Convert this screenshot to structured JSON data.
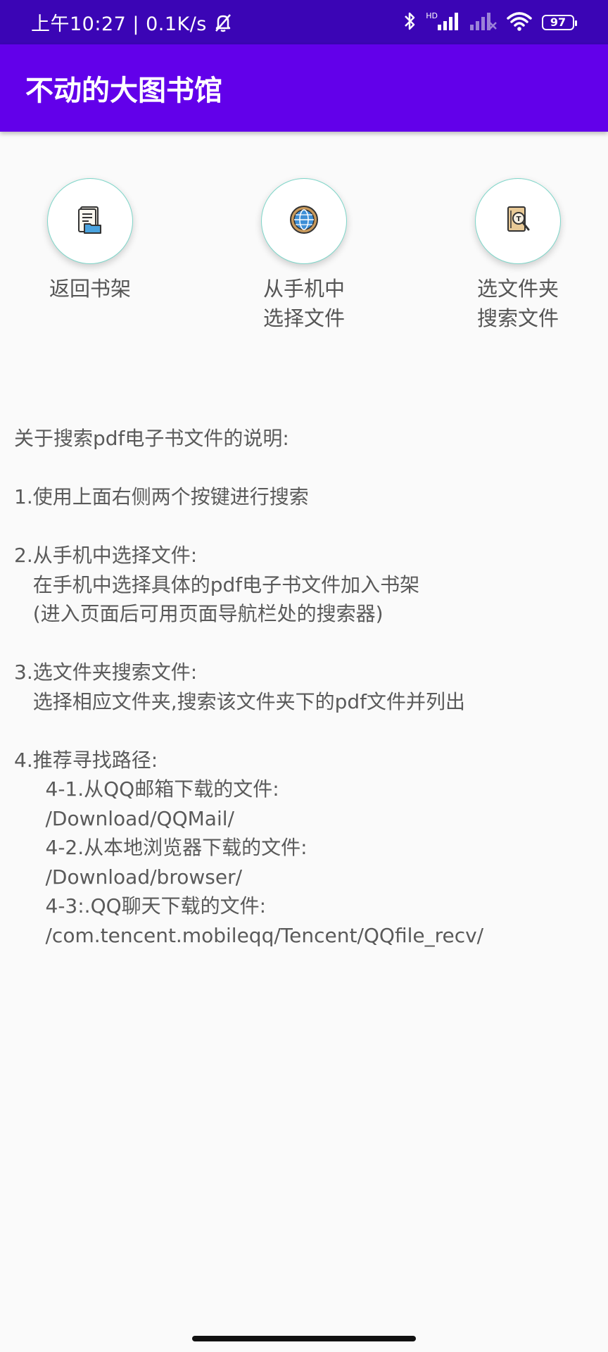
{
  "status_bar": {
    "time_speed": "上午10:27 | 0.1K/s",
    "hd_label": "HD",
    "battery_level": "97",
    "icons": [
      "bell-off-icon",
      "bluetooth-icon",
      "signal-icon",
      "signal-no-service-icon",
      "wifi-icon",
      "battery-icon"
    ]
  },
  "app_bar": {
    "title": "不动的大图书馆"
  },
  "actions": [
    {
      "icon": "document-folder-icon",
      "label_line1": "返回书架",
      "label_line2": ""
    },
    {
      "icon": "globe-icon",
      "label_line1": "从手机中",
      "label_line2": "选择文件"
    },
    {
      "icon": "search-file-icon",
      "label_line1": "选文件夹",
      "label_line2": "搜索文件"
    }
  ],
  "notes": [
    "关于搜索pdf电子书文件的说明:",
    "",
    "1.使用上面右侧两个按键进行搜索",
    "",
    "2.从手机中选择文件:",
    "   在手机中选择具体的pdf电子书文件加入书架",
    "   (进入页面后可用页面导航栏处的搜索器)",
    "",
    "3.选文件夹搜索文件:",
    "   选择相应文件夹,搜索该文件夹下的pdf文件并列出",
    "",
    "4.推荐寻找路径:",
    "     4-1.从QQ邮箱下载的文件:",
    "     /Download/QQMail/",
    "     4-2.从本地浏览器下载的文件:",
    "     /Download/browser/",
    "     4-3:.QQ聊天下载的文件:",
    "     /com.tencent.mobileqq/Tencent/QQfile_recv/"
  ]
}
